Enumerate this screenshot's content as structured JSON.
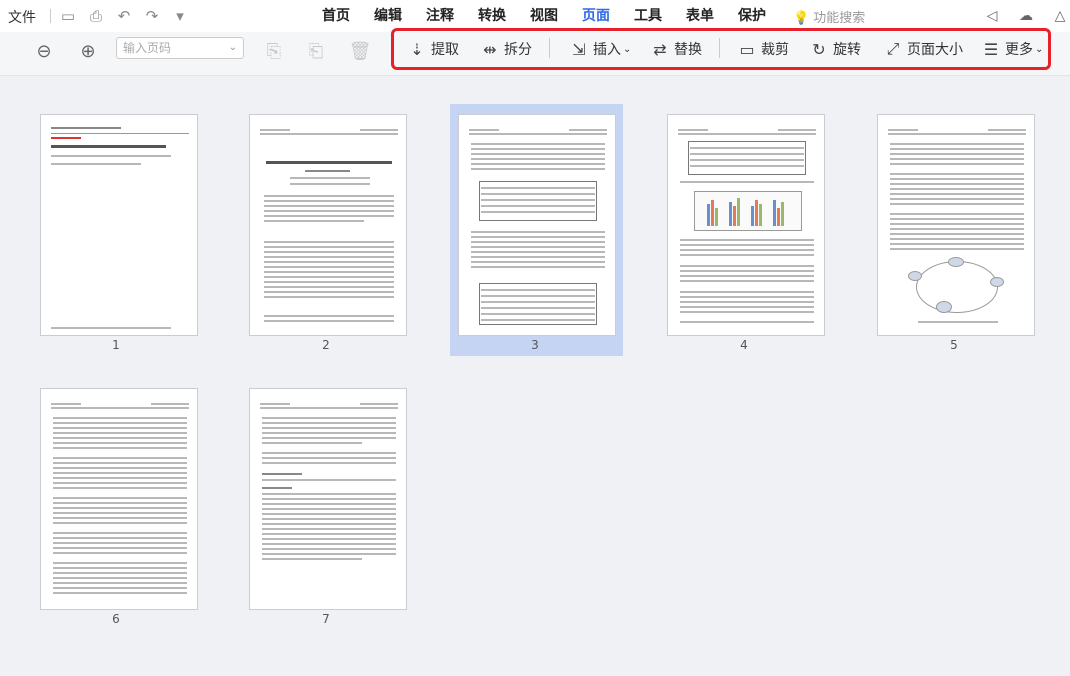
{
  "menubar": {
    "file_label": "文件",
    "tabs": [
      {
        "label": "首页"
      },
      {
        "label": "编辑"
      },
      {
        "label": "注释"
      },
      {
        "label": "转换"
      },
      {
        "label": "视图"
      },
      {
        "label": "页面"
      },
      {
        "label": "工具"
      },
      {
        "label": "表单"
      },
      {
        "label": "保护"
      }
    ],
    "active_tab": "页面",
    "search_label": "功能搜索"
  },
  "toolbar": {
    "page_input_placeholder": "输入页码",
    "actions": {
      "extract": "提取",
      "split": "拆分",
      "insert": "插入",
      "replace": "替换",
      "crop": "裁剪",
      "rotate": "旋转",
      "page_size": "页面大小",
      "more": "更多"
    }
  },
  "pages": [
    {
      "number": "1"
    },
    {
      "number": "2"
    },
    {
      "number": "3"
    },
    {
      "number": "4"
    },
    {
      "number": "5"
    },
    {
      "number": "6"
    },
    {
      "number": "7"
    }
  ],
  "selected_page": "3",
  "colors": {
    "accent": "#2f6be6",
    "highlight_border": "#e8202a",
    "selection_bg": "#c6d4f4"
  }
}
